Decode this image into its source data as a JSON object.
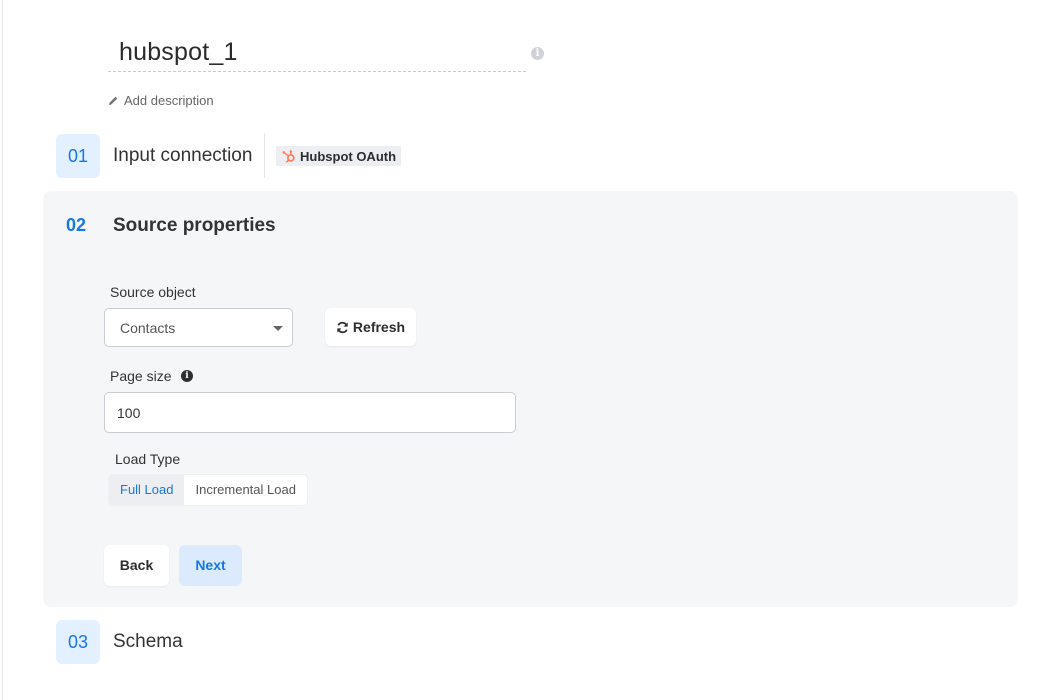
{
  "header": {
    "title": "hubspot_1",
    "add_description": "Add description"
  },
  "steps": [
    {
      "number": "01",
      "label": "Input connection"
    },
    {
      "number": "02",
      "label": "Source properties"
    },
    {
      "number": "03",
      "label": "Schema"
    }
  ],
  "connection": {
    "name": "Hubspot OAuth",
    "icon": "hubspot-logo-icon",
    "brand_color": "#ff7a59"
  },
  "source_properties": {
    "source_object": {
      "label": "Source object",
      "value": "Contacts"
    },
    "refresh_label": "Refresh",
    "page_size": {
      "label": "Page size",
      "value": "100"
    },
    "load_type": {
      "label": "Load Type",
      "options": [
        "Full Load",
        "Incremental Load"
      ],
      "selected": "Full Load"
    },
    "back_label": "Back",
    "next_label": "Next"
  },
  "colors": {
    "accent": "#1677e6",
    "accent_light": "#e3f0ff",
    "panel_bg": "#f5f6f8"
  }
}
